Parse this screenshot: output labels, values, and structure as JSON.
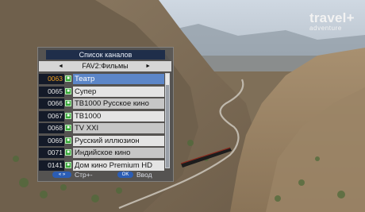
{
  "overlay": {
    "logo_line1": "travel+",
    "logo_line2": "adventure"
  },
  "channel_list": {
    "title": "Список каналов",
    "category": "FAV2:Фильмы",
    "nav_left_icon": "arrow-left-icon",
    "nav_right_icon": "arrow-right-icon",
    "channels": [
      {
        "number": "0063",
        "name": "Театр",
        "selected": true
      },
      {
        "number": "0065",
        "name": "Супер",
        "selected": false
      },
      {
        "number": "0066",
        "name": "ТВ1000 Русское кино",
        "selected": false
      },
      {
        "number": "0067",
        "name": "ТВ1000",
        "selected": false
      },
      {
        "number": "0068",
        "name": "TV XXI",
        "selected": false
      },
      {
        "number": "0069",
        "name": "Русский иллюзион",
        "selected": false
      },
      {
        "number": "0071",
        "name": "Индийское кино",
        "selected": false
      },
      {
        "number": "0141",
        "name": "Дом кино Premium HD",
        "selected": false
      }
    ],
    "footer": {
      "page_key": "« »",
      "page_label": "Стр+-",
      "ok_key": "OK",
      "ok_label": "Ввод"
    }
  },
  "colors": {
    "selected_row": "#5c86c8",
    "number_highlight": "#f0a020",
    "title_bar": "#1f2e4a",
    "key_button": "#2b5db4"
  }
}
